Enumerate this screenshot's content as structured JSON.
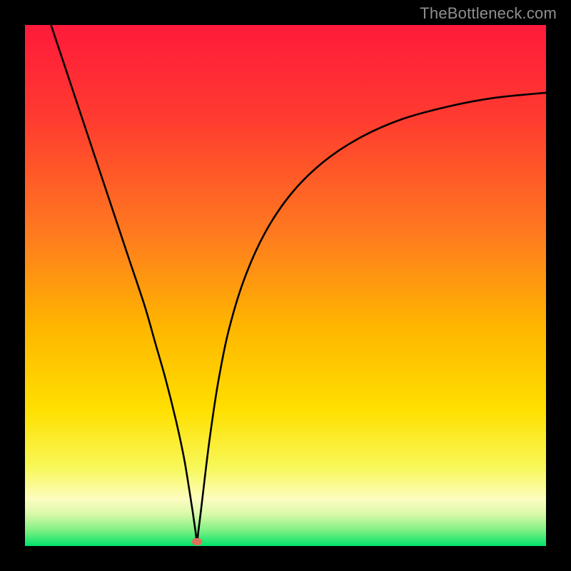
{
  "watermark": "TheBottleneck.com",
  "colors": {
    "frame": "#000000",
    "gradient_stops": [
      {
        "pct": 0,
        "color": "#ff1a3a"
      },
      {
        "pct": 18,
        "color": "#ff3b30"
      },
      {
        "pct": 40,
        "color": "#ff7a1f"
      },
      {
        "pct": 58,
        "color": "#ffb600"
      },
      {
        "pct": 74,
        "color": "#ffe000"
      },
      {
        "pct": 85,
        "color": "#f8f85a"
      },
      {
        "pct": 91,
        "color": "#fdfdc0"
      },
      {
        "pct": 94,
        "color": "#d6f9a8"
      },
      {
        "pct": 97,
        "color": "#7ff083"
      },
      {
        "pct": 100,
        "color": "#00e46b"
      }
    ],
    "curve": "#000000",
    "marker": "#e0705a"
  },
  "chart_data": {
    "type": "line",
    "title": "",
    "xlabel": "",
    "ylabel": "",
    "xlim": [
      0,
      100
    ],
    "ylim": [
      0,
      100
    ],
    "series": [
      {
        "name": "bottleneck-curve",
        "x": [
          5,
          8,
          11,
          14,
          17,
          20,
          23,
          25,
          27,
          29,
          30.5,
          31.5,
          32.2,
          32.7,
          33,
          33.3,
          33.8,
          34.5,
          35.5,
          37,
          39,
          42,
          46,
          51,
          57,
          64,
          72,
          81,
          90,
          100
        ],
        "y": [
          100,
          91,
          82,
          73,
          64,
          55,
          46,
          39,
          32,
          24,
          17,
          11,
          6.5,
          3,
          1,
          3,
          7,
          13,
          21,
          31,
          41,
          51,
          60,
          67.5,
          73.5,
          78.2,
          81.8,
          84.3,
          86.0,
          87.0
        ]
      }
    ],
    "annotations": [
      {
        "name": "min-marker",
        "x": 33,
        "y": 0.8
      }
    ]
  }
}
